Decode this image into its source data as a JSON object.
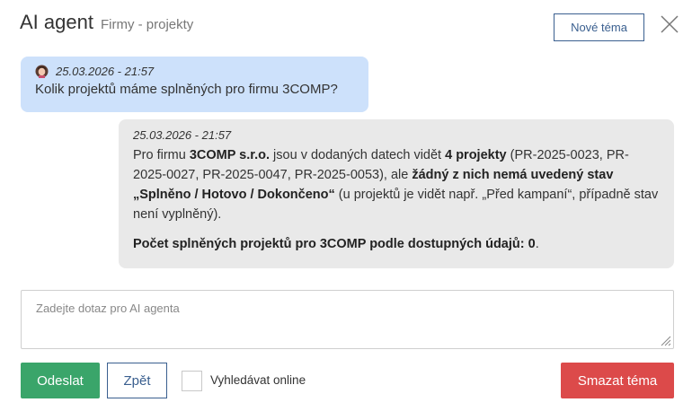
{
  "header": {
    "title": "AI agent",
    "subtitle": "Firmy - projekty",
    "new_topic_label": "Nové téma"
  },
  "messages": {
    "user": {
      "timestamp": "25.03.2026 - 21:57",
      "text": "Kolik projektů máme splněných pro firmu 3COMP?"
    },
    "agent": {
      "timestamp": "25.03.2026 - 21:57",
      "p1": {
        "t1": "Pro firmu ",
        "b1": "3COMP s.r.o.",
        "t2": " jsou v dodaných datech vidět ",
        "b2": "4 projekty",
        "t3": " (PR-2025-0023, PR-2025-0027, PR-2025-0047, PR-2025-0053), ale ",
        "b3": "žádný z nich nemá uvedený stav „Splněno / Hotovo / Dokončeno“",
        "t4": " (u projektů je vidět např. „Před kampaní“, případně stav není vyplněný)."
      },
      "p2": {
        "b1": "Počet splněných projektů pro 3COMP podle dostupných údajů: 0",
        "t1": "."
      }
    }
  },
  "input": {
    "placeholder": "Zadejte dotaz pro AI agenta",
    "value": ""
  },
  "actions": {
    "send_label": "Odeslat",
    "back_label": "Zpět",
    "online_label": "Vyhledávat online",
    "online_checked": false,
    "delete_label": "Smazat téma"
  },
  "colors": {
    "user_bubble": "#cde1fb",
    "agent_bubble": "#e9e9e9",
    "send": "#3aa56a",
    "delete": "#dc4a4a",
    "outline": "#3a5f8f"
  }
}
